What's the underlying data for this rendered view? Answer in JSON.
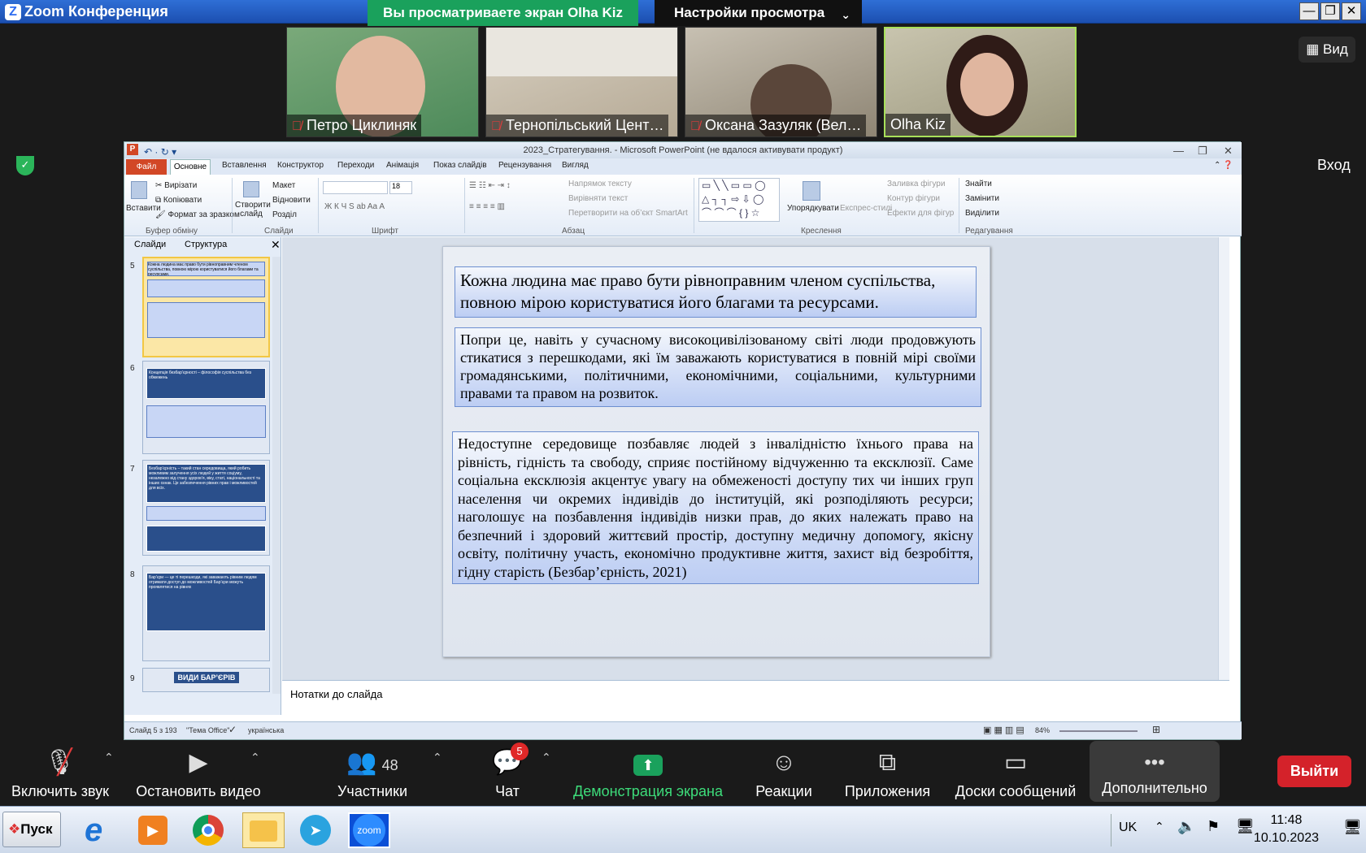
{
  "window": {
    "title": "Zoom Конференция",
    "share_banner": "Вы просматриваете экран Olha Kiz",
    "view_settings": "Настройки просмотра"
  },
  "participants": [
    {
      "name": "Петро Циклиняк",
      "muted": true
    },
    {
      "name": "Тернопільський Цент…",
      "muted": true
    },
    {
      "name": "Оксана Зазуляк (Вел…",
      "muted": true
    },
    {
      "name": "Olha Kiz",
      "muted": false
    }
  ],
  "view_button": "Вид",
  "enter_label": "Вход",
  "ppt": {
    "title": "2023_Стратегування. - Microsoft PowerPoint (не вдалося активувати продукт)",
    "tabs": [
      "Файл",
      "Основне",
      "Вставлення",
      "Конструктор",
      "Переходи",
      "Анімація",
      "Показ слайдів",
      "Рецензування",
      "Вигляд"
    ],
    "ribbon": {
      "paste": "Вставити",
      "cut": "Вирізати",
      "copy": "Копіювати",
      "format_painter": "Формат за зразком",
      "clipboard": "Буфер обміну",
      "new_slide": "Створити слайд",
      "layout": "Макет",
      "reset": "Відновити",
      "section": "Розділ",
      "slides": "Слайди",
      "font_size": "18",
      "font": "Шрифт",
      "text_direction": "Напрямок тексту",
      "align_text": "Вирівняти текст",
      "convert_smartart": "Перетворити на об’єкт SmartArt",
      "paragraph": "Абзац",
      "arrange": "Упорядкувати",
      "quick_styles": "Експрес-стилі",
      "shape_fill": "Заливка фігури",
      "shape_outline": "Контур фігури",
      "shape_effects": "Ефекти для фігур",
      "drawing": "Креслення",
      "find": "Знайти",
      "replace": "Замінити",
      "select": "Виділити",
      "editing": "Редагування"
    },
    "pane_tabs": {
      "slides": "Слайди",
      "outline": "Структура"
    },
    "thumbs": [
      {
        "num": "5",
        "text": "Кожна людина має право бути рівноправним членом суспільства, повною мірою користуватися його благами та ресурсами."
      },
      {
        "num": "6",
        "text": "Концепція безбар’єрності – філософія суспільства без обмежень"
      },
      {
        "num": "7",
        "text": "Безбар’єрність – такий стан середовища, який робить можливим залучення усіх людей у життя соціуму, незалежно від стану здоров’я, віку, статі, національності та інших ознак.",
        "sub": "Це забезпечення рівних прав і можливостей для всіх."
      },
      {
        "num": "8",
        "text": "Бар’єри — це ті перешкоди, які заважають рівним людям отримати доступ до можливостей",
        "sub": "Бар’єри можуть проявлятися на рівнях"
      },
      {
        "num": "9",
        "text": "ВИДИ БАР’ЄРІВ"
      }
    ],
    "slide": {
      "box1": "Кожна людина має право бути рівноправним членом суспільства, повною мірою користуватися його благами та ресурсами.",
      "box2": "Попри це, навіть у сучасному високоцивілізованому світі люди продовжують стикатися з перешкодами, які їм заважають користуватися в повній мірі своїми громадянськими, політичними, економічними, соціальними, культурними правами та правом на розвиток.",
      "box3": "Недоступне середовище позбавляє людей з інвалідністю їхнього права на рівність, гідність та свободу, сприяє постійному відчуженню та ексклюзії. Саме соціальна ексклюзія акцентує увагу на обмеженості доступу тих чи інших груп населення чи окремих індивідів до інституцій, які розподіляють ресурси; наголошує на позбавлення індивідів низки прав, до яких належать право на безпечний і здоровий життєвий простір, доступну медичну допомогу, якісну освіту, політичну участь, економічно продуктивне життя, захист від безробіття, гідну старість (Безбар’єрність, 2021)"
    },
    "notes_placeholder": "Нотатки до слайда",
    "status": {
      "slide": "Слайд 5 з 193",
      "theme": "\"Тема Office\"",
      "lang": "українська",
      "zoom": "84%"
    }
  },
  "toolbar": {
    "unmute": "Включить звук",
    "stop_video": "Остановить видео",
    "participants": "Участники",
    "participants_count": "48",
    "chat": "Чат",
    "chat_badge": "5",
    "share": "Демонстрация экрана",
    "reactions": "Реакции",
    "apps": "Приложения",
    "whiteboards": "Доски сообщений",
    "more": "Дополнительно",
    "leave": "Выйти"
  },
  "taskbar": {
    "start": "Пуск",
    "lang": "UK",
    "time": "11:48",
    "date": "10.10.2023",
    "apps": [
      "ie-icon",
      "media-player-icon",
      "chrome-icon",
      "explorer-icon",
      "telegram-icon",
      "zoom-icon"
    ]
  },
  "colors": {
    "share_green": "#1aa15c",
    "leave_red": "#d4222a",
    "ppt_orange": "#d24726"
  }
}
